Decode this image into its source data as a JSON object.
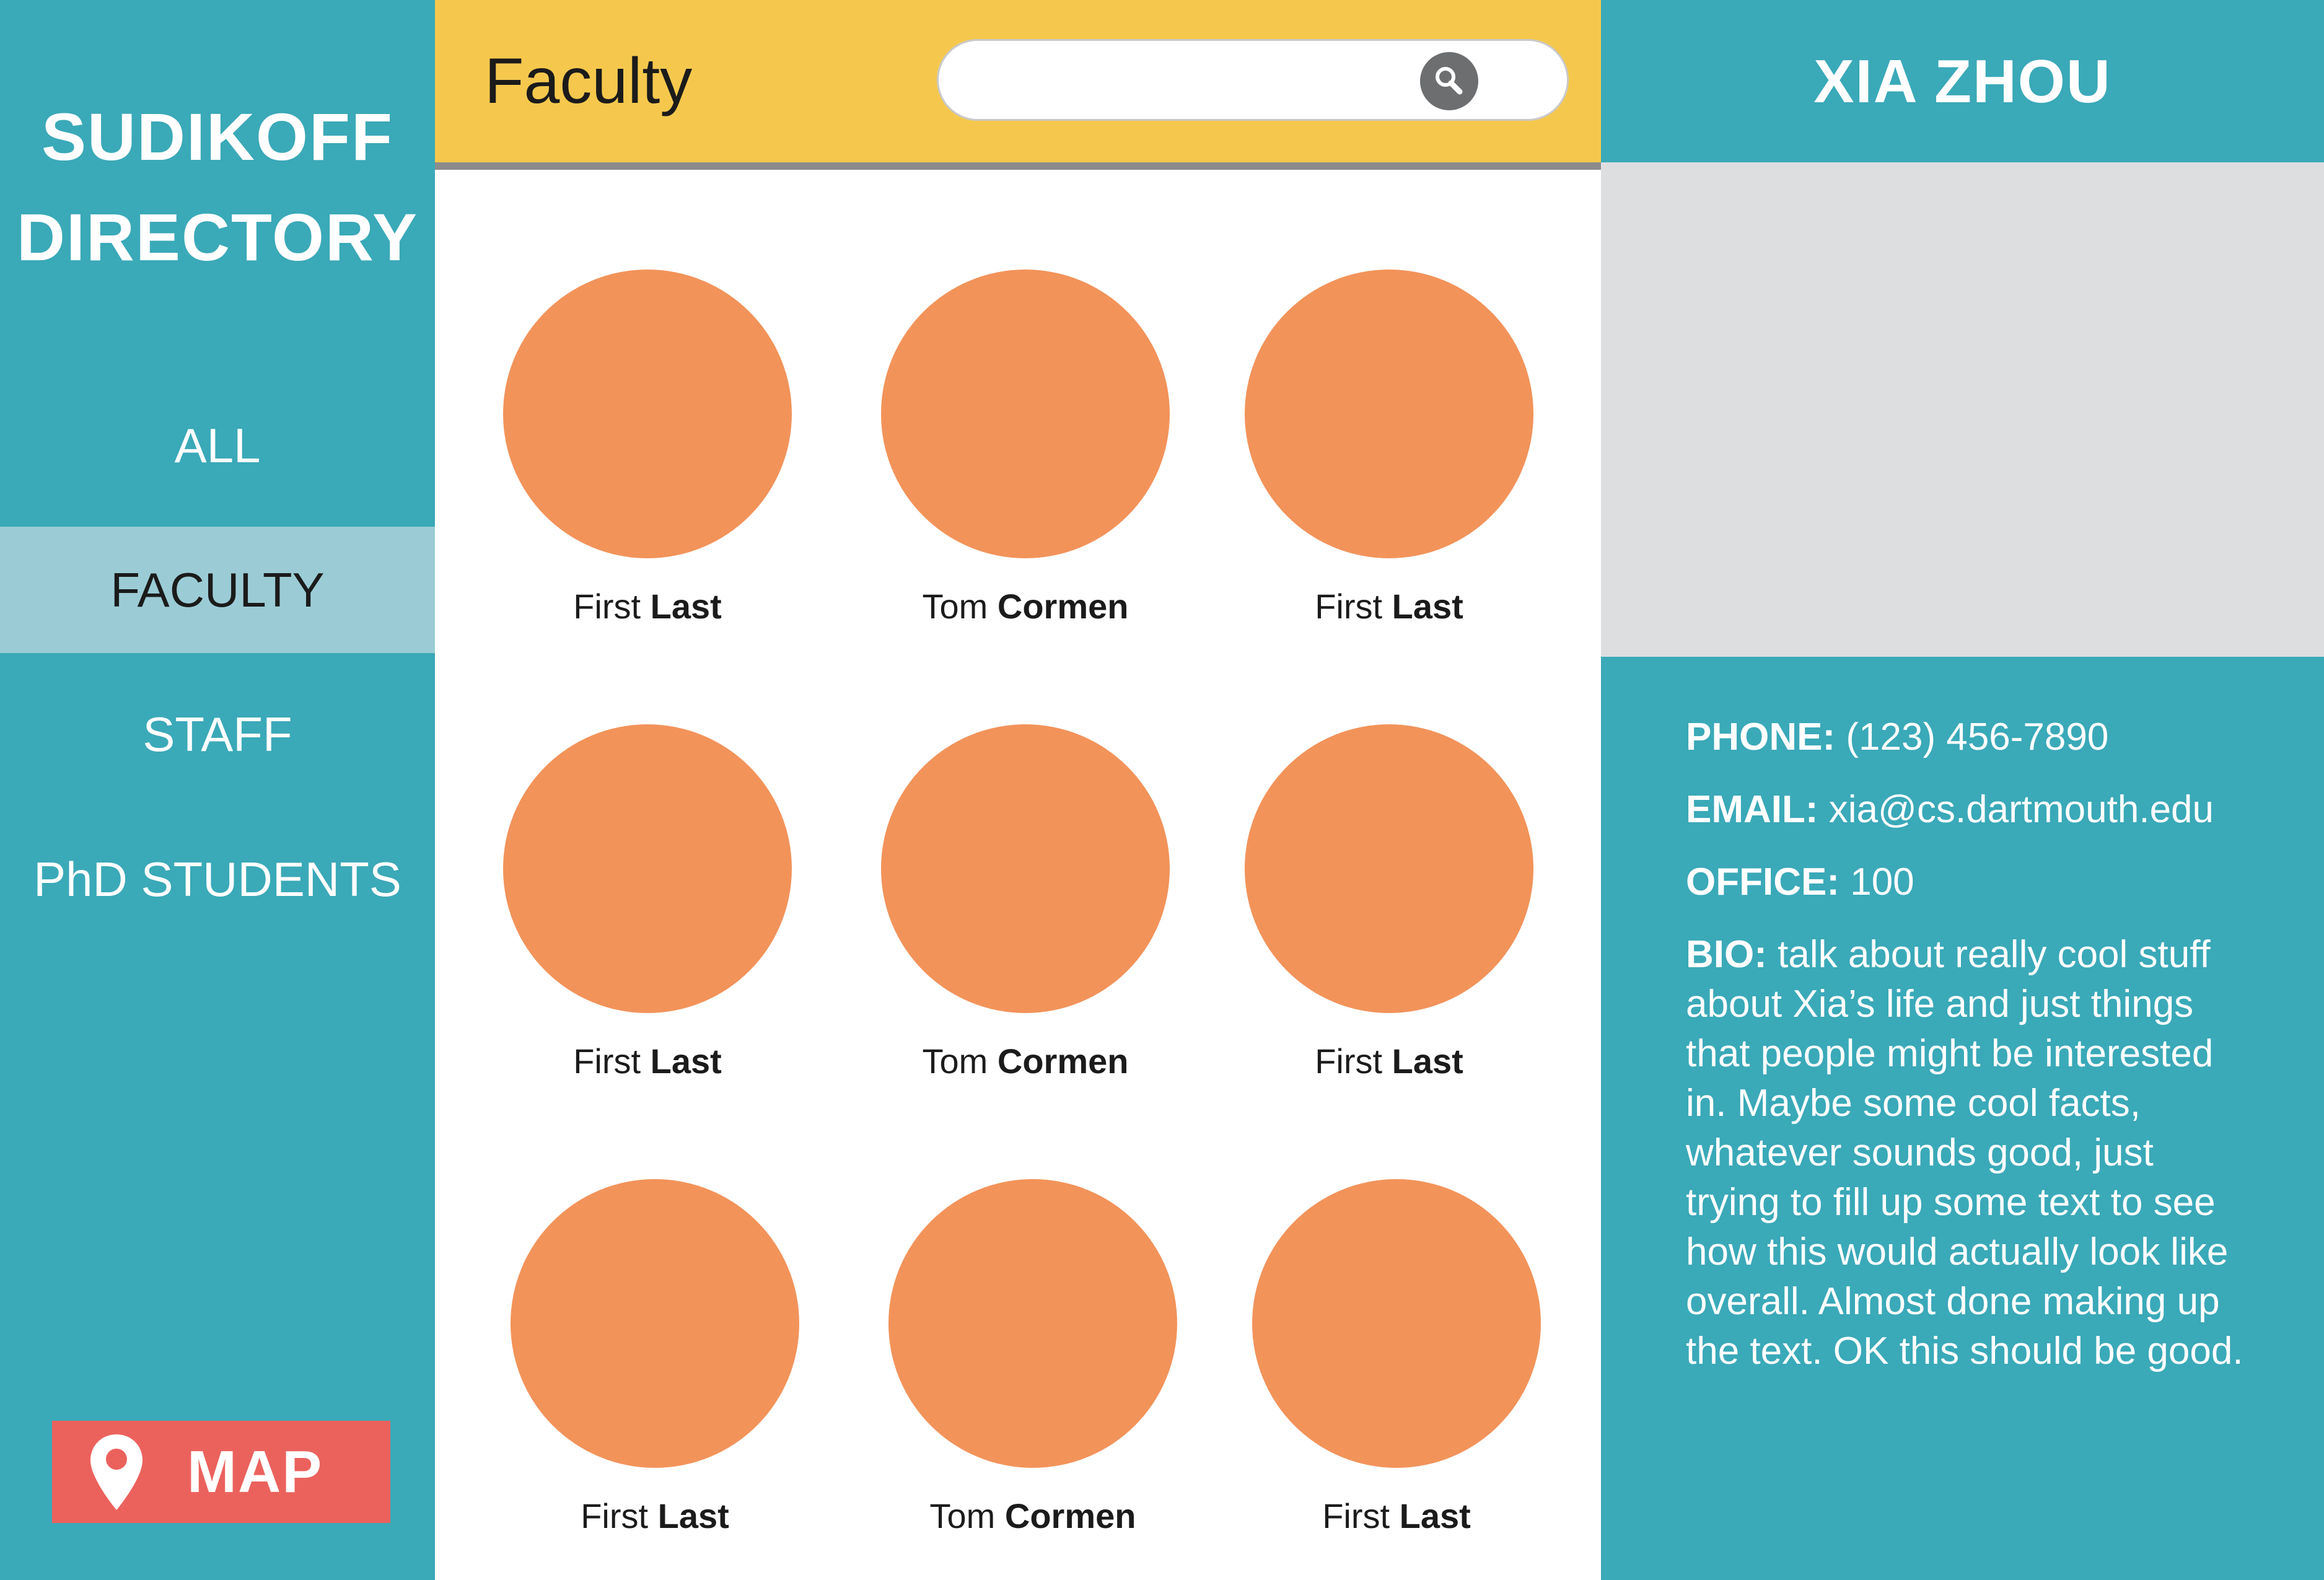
{
  "sidebar": {
    "title_line1": "SUDIKOFF",
    "title_line2": "DIRECTORY",
    "nav": [
      {
        "label": "ALL"
      },
      {
        "label": "FACULTY"
      },
      {
        "label": "STAFF"
      },
      {
        "label": "PhD STUDENTS"
      }
    ],
    "active_nav": "FACULTY",
    "map_button": {
      "label": "MAP",
      "icon": "map-pin-icon"
    }
  },
  "header": {
    "title": "Faculty",
    "search": {
      "value": "",
      "placeholder": "",
      "icon": "search-icon"
    }
  },
  "people": [
    {
      "first": "First",
      "last": "Last"
    },
    {
      "first": "Tom",
      "last": "Cormen"
    },
    {
      "first": "First",
      "last": "Last"
    },
    {
      "first": "First",
      "last": "Last"
    },
    {
      "first": "Tom",
      "last": "Cormen"
    },
    {
      "first": "First",
      "last": "Last"
    },
    {
      "first": "First",
      "last": "Last"
    },
    {
      "first": "Tom",
      "last": "Cormen"
    },
    {
      "first": "First",
      "last": "Last"
    }
  ],
  "profile": {
    "name": "XIA ZHOU",
    "phone_label": "PHONE:",
    "phone": "(123) 456-7890",
    "email_label": "EMAIL:",
    "email": "xia@cs.dartmouth.edu",
    "office_label": "OFFICE:",
    "office": "100",
    "bio_label": "BIO:",
    "bio": "talk about really cool stuff about Xia’s life and just things that people might be interested in. Maybe some cool facts, whatever sounds good, just trying to fill up some text to see how this would actually look like overall. Almost done making up the text. OK this should be good."
  },
  "colors": {
    "teal": "#3aa9b8",
    "active_nav": "#9bccd6",
    "header_yellow": "#f5c84d",
    "avatar_orange": "#f2935a",
    "map_red": "#eb625d",
    "photo_gray": "#dcdee0"
  }
}
